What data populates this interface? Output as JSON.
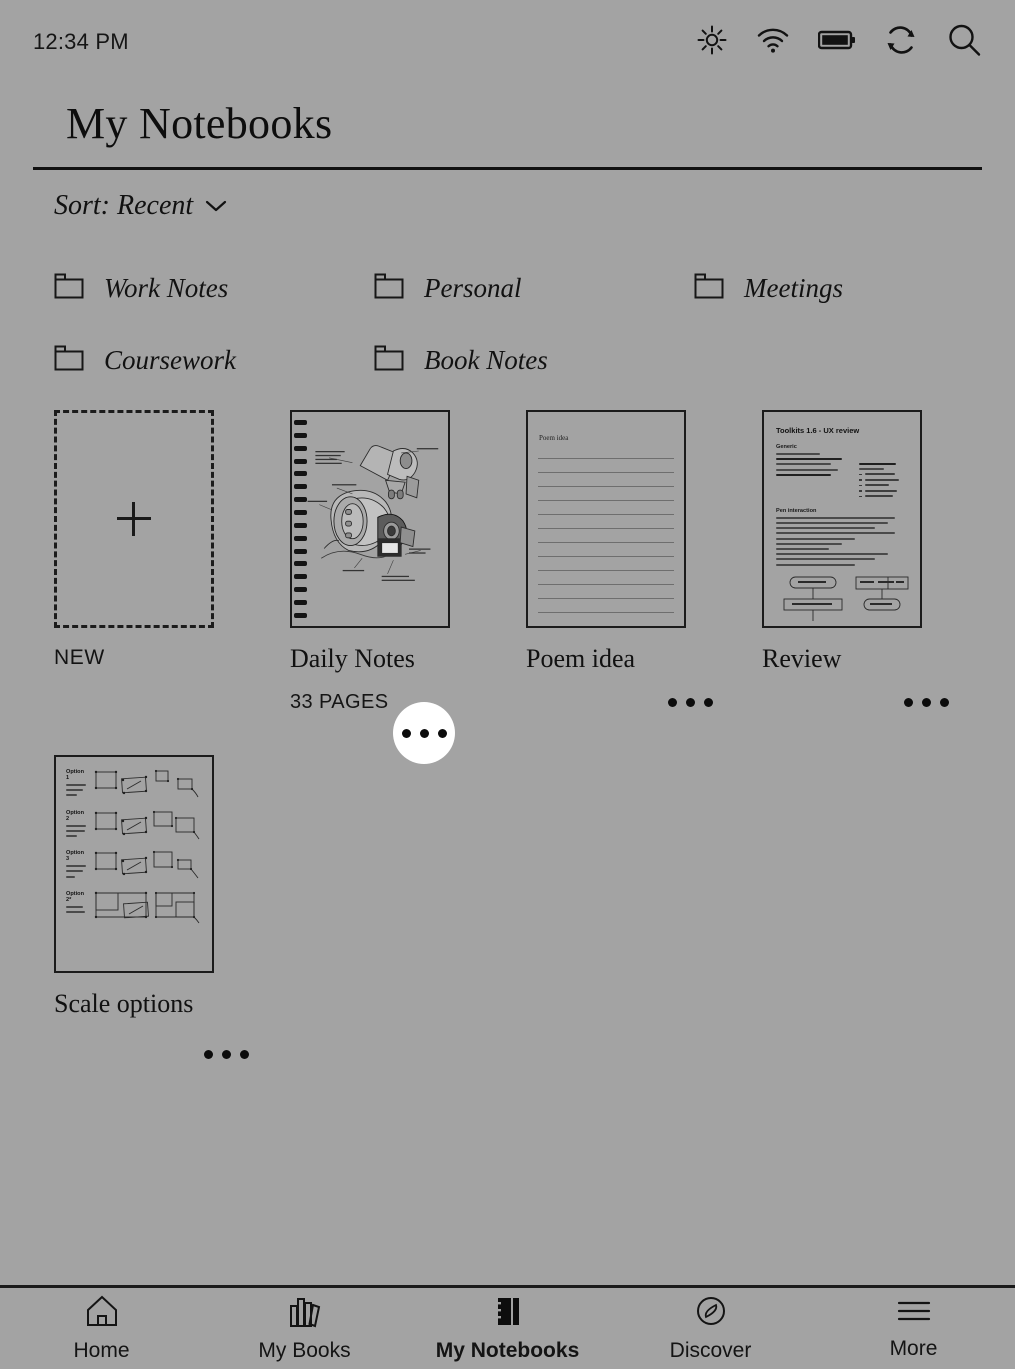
{
  "status": {
    "time": "12:34 PM",
    "icons": [
      "brightness-icon",
      "wifi-icon",
      "battery-icon",
      "sync-icon",
      "search-icon"
    ]
  },
  "header": {
    "title": "My Notebooks",
    "sort_label": "Sort: Recent",
    "sort_chevron": "chevron-down-icon"
  },
  "folders": [
    {
      "name": "Work Notes"
    },
    {
      "name": "Personal"
    },
    {
      "name": "Meetings"
    },
    {
      "name": "Coursework"
    },
    {
      "name": "Book Notes"
    }
  ],
  "new_card": {
    "label": "NEW",
    "icon": "plus-icon"
  },
  "notebooks": [
    {
      "title": "Daily Notes",
      "pages": "33 PAGES",
      "thumb": "spiral-sketch",
      "menu_highlighted": true,
      "menu_label": "•••"
    },
    {
      "title": "Poem idea",
      "pages": "",
      "thumb": "lined-page",
      "thumb_title": "Poem idea",
      "menu_highlighted": false
    },
    {
      "title": "Review",
      "pages": "",
      "thumb": "review-doc",
      "thumb_heading": "Toolkits 1.6 - UX review",
      "thumb_section_1": "Generic",
      "thumb_section_2": "Pen interaction",
      "menu_highlighted": false
    },
    {
      "title": "Scale options",
      "pages": "",
      "thumb": "scale-options",
      "thumb_options": [
        "Option 1",
        "Option 2",
        "Option 3",
        "Option 2*"
      ],
      "menu_highlighted": false
    }
  ],
  "nav": [
    {
      "label": "Home",
      "icon": "home-icon",
      "active": false
    },
    {
      "label": "My Books",
      "icon": "books-icon",
      "active": false
    },
    {
      "label": "My Notebooks",
      "icon": "notebook-icon",
      "active": true
    },
    {
      "label": "Discover",
      "icon": "compass-icon",
      "active": false
    },
    {
      "label": "More",
      "icon": "hamburger-icon",
      "active": false
    }
  ],
  "colors": {
    "background": "#a3a3a3",
    "ink": "#111111",
    "highlight": "#ffffff"
  }
}
